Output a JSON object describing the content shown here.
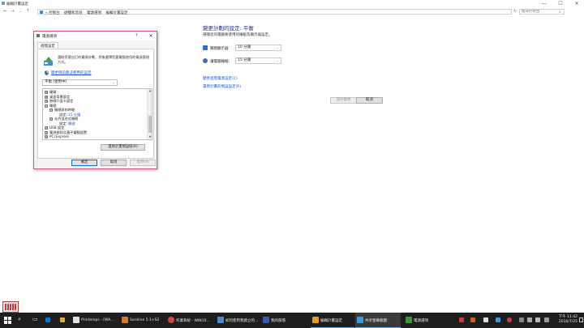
{
  "window": {
    "title": "編輯計畫設定",
    "min": "—",
    "max": "☐",
    "close": "✕"
  },
  "nav": {
    "back": "←",
    "forward": "→",
    "recent": "⌄",
    "up": "↑",
    "dropdown": "⌄",
    "refresh": "↻",
    "breadcrumb": [
      "« 控制台",
      "硬體和音效",
      "電源選項",
      "編輯計畫設定"
    ],
    "search_placeholder": "搜尋控制台",
    "search_glyph": "⌕"
  },
  "main": {
    "heading": "變更計劃的設定: 平衡",
    "subheading": "選擇您的電腦要使用的睡眠及顯示器設定。",
    "rows": [
      {
        "label": "關閉顯示器:",
        "value": "10 分鐘",
        "icon_color": "#2f6fb5"
      },
      {
        "label": "讓電腦睡眠:",
        "value": "15 分鐘",
        "icon_color": "#3a6fb0"
      }
    ],
    "links": [
      "變更進階電源設定(C)",
      "還原計畫的預設設定(R)"
    ],
    "save": "儲存變更",
    "cancel": "取消"
  },
  "dialog": {
    "title": "電源選項",
    "help": "?",
    "close": "✕",
    "tab": "進階設定",
    "description": "選取您要自訂的電源計劃，然後選擇您要電腦使用的電源管理方式。",
    "link": "變更目前無法使用的設定",
    "plan": "平衡 [使用中]",
    "tree": [
      {
        "toggle": "⊞",
        "label": "硬碟",
        "indent": 0
      },
      {
        "toggle": "⊞",
        "label": "桌面背景設定",
        "indent": 0
      },
      {
        "toggle": "⊞",
        "label": "無線介面卡設定",
        "indent": 0
      },
      {
        "toggle": "⊟",
        "label": "睡眠",
        "indent": 0
      },
      {
        "toggle": "⊟",
        "label": "睡眠前的時間",
        "indent": 1
      },
      {
        "toggle": "",
        "label": "設定:",
        "value": "15 分鐘",
        "indent": 2
      },
      {
        "toggle": "⊟",
        "label": "允許混合式睡眠",
        "indent": 1
      },
      {
        "toggle": "",
        "label": "設定:",
        "value": "開啟",
        "indent": 2
      },
      {
        "toggle": "⊞",
        "label": "USB 設定",
        "indent": 0
      },
      {
        "toggle": "⊞",
        "label": "電源按鈕及蓋子電腦設置",
        "indent": 0
      },
      {
        "toggle": "⊞",
        "label": "PCI Express",
        "indent": 0
      }
    ],
    "restore": "還原計畫預設值(R)",
    "ok": "確定",
    "cancel": "取消",
    "apply": "套用(A)"
  },
  "taskbar": {
    "start_glyph": "⊞",
    "search_glyph": "⌕",
    "taskview_glyph": "▭",
    "tasks": [
      {
        "label": "Printemps - [WA…",
        "color": "#e0e0e0"
      },
      {
        "label": "Soroline 5.1+S2",
        "color": "#d07a2a"
      },
      {
        "label": "作業系統 - WIN10…",
        "color": "#d04a3a"
      },
      {
        "label": "如何使用我建立的…",
        "color": "#4a8ad0"
      },
      {
        "label": "我的部落",
        "color": "#3a5ab0"
      },
      {
        "label": "編輯計畫設定",
        "color": "#e0a020"
      },
      {
        "label": "共享螢幕截圖",
        "color": "#3a9ad8"
      },
      {
        "label": "電源選項",
        "color": "#3a9a3a"
      }
    ],
    "time": "下午 11:42",
    "date": "2016/7/25"
  },
  "colors": {
    "accent": "#1e3287",
    "link": "#1a54c8",
    "taskbar": "#1e1e1e",
    "dialog_border": "#d05a7a"
  }
}
